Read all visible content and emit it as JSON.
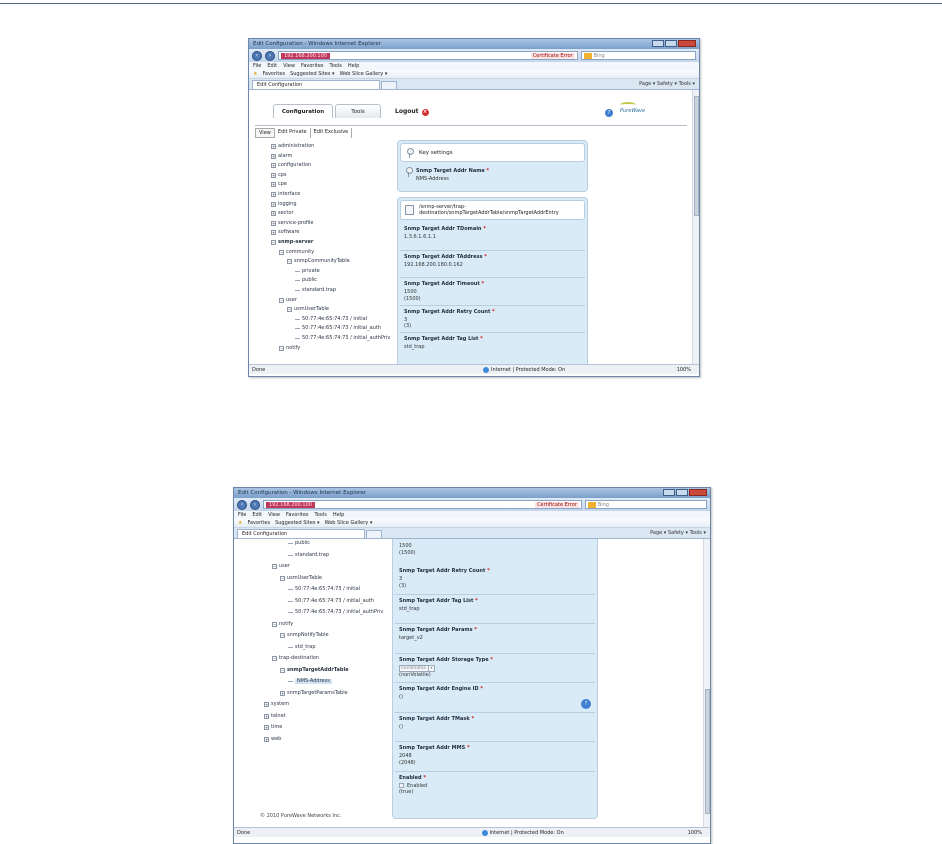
{
  "browser": {
    "title": "Edit Configuration - Windows Internet Explorer",
    "url": "192.168.200.100",
    "certificate_error": "Certificate Error",
    "search_placeholder": "Bing",
    "menu": [
      "File",
      "Edit",
      "View",
      "Favorites",
      "Tools",
      "Help"
    ],
    "favorites_label": "Favorites",
    "suggested_sites": "Suggested Sites ▾",
    "web_slice_gallery": "Web Slice Gallery ▾",
    "tab_title": "Edit Configuration",
    "command_bar": "Page ▾  Safety ▾  Tools ▾",
    "status_left": "Done",
    "status_zone": "Internet | Protected Mode: On",
    "zoom": "100%"
  },
  "app": {
    "tabs": [
      "Configuration",
      "Tools"
    ],
    "logout": "Logout",
    "logo": "PureWave",
    "subtabs": [
      "View",
      "Edit Private",
      "Edit Exclusive"
    ],
    "copyright": "© 2010 PureWave Networks Inc."
  },
  "window1": {
    "tree": [
      {
        "label": "administration",
        "kind": "plus"
      },
      {
        "label": "alarm",
        "kind": "plus"
      },
      {
        "label": "configuration",
        "kind": "plus"
      },
      {
        "label": "cps",
        "kind": "plus"
      },
      {
        "label": "cpe",
        "kind": "plus"
      },
      {
        "label": "interface",
        "kind": "plus"
      },
      {
        "label": "logging",
        "kind": "plus"
      },
      {
        "label": "sector",
        "kind": "plus"
      },
      {
        "label": "service-profile",
        "kind": "plus"
      },
      {
        "label": "software",
        "kind": "plus"
      },
      {
        "label": "snmp-server",
        "kind": "minus",
        "bold": true
      },
      {
        "label": "community",
        "kind": "minus",
        "indent": 1
      },
      {
        "label": "snmpCommunityTable",
        "kind": "minus",
        "indent": 2
      },
      {
        "label": "private",
        "kind": "leaf",
        "indent": 3
      },
      {
        "label": "public",
        "kind": "leaf",
        "indent": 3
      },
      {
        "label": "standard.trap",
        "kind": "leaf",
        "indent": 3
      },
      {
        "label": "user",
        "kind": "minus",
        "indent": 1
      },
      {
        "label": "usmUserTable",
        "kind": "minus",
        "indent": 2
      },
      {
        "label": "50:77:4e:65:74:73 / initial",
        "kind": "leaf",
        "indent": 3
      },
      {
        "label": "50:77:4e:65:74:73 / initial_auth",
        "kind": "leaf",
        "indent": 3
      },
      {
        "label": "50:77:4e:65:74:73 / initial_authPriv",
        "kind": "leaf",
        "indent": 3
      },
      {
        "label": "notify",
        "kind": "minus",
        "indent": 1
      }
    ],
    "key_settings_title": "Key settings",
    "key_field_label": "Snmp Target Addr Name",
    "key_field_value": "NMS-Address",
    "path_title": "/snmp-server/trap-destination/snmpTargetAddrTable/snmpTargetAddrEntry",
    "fields": [
      {
        "label": "Snmp Target Addr TDomain",
        "value": "1.3.6.1.6.1.1",
        "value2": ""
      },
      {
        "label": "Snmp Target Addr TAddress",
        "value": "192.168.200.180.0.162",
        "value2": ""
      },
      {
        "label": "Snmp Target Addr Timeout",
        "value": "1500",
        "value2": "(1500)"
      },
      {
        "label": "Snmp Target Addr Retry Count",
        "value": "3",
        "value2": "(3)"
      },
      {
        "label": "Snmp Target Addr Tag List",
        "value": "std_trap",
        "value2": ""
      }
    ]
  },
  "window2": {
    "tree": [
      {
        "label": "public",
        "kind": "leaf",
        "indent": 3
      },
      {
        "label": "standard.trap",
        "kind": "leaf",
        "indent": 3
      },
      {
        "label": "user",
        "kind": "minus",
        "indent": 1
      },
      {
        "label": "usmUserTable",
        "kind": "minus",
        "indent": 2
      },
      {
        "label": "50:77:4e:65:74:73 / initial",
        "kind": "leaf",
        "indent": 3
      },
      {
        "label": "50:77:4e:65:74:73 / initial_auth",
        "kind": "leaf",
        "indent": 3
      },
      {
        "label": "50:77:4e:65:74:73 / initial_authPriv",
        "kind": "leaf",
        "indent": 3
      },
      {
        "label": "notify",
        "kind": "minus",
        "indent": 1
      },
      {
        "label": "snmpNotifyTable",
        "kind": "minus",
        "indent": 2
      },
      {
        "label": "std_trap",
        "kind": "leaf",
        "indent": 3
      },
      {
        "label": "trap-destination",
        "kind": "minus",
        "indent": 1
      },
      {
        "label": "snmpTargetAddrTable",
        "kind": "minus",
        "indent": 2,
        "bold": true
      },
      {
        "label": "NMS-Address",
        "kind": "leaf",
        "indent": 3,
        "selected": true
      },
      {
        "label": "snmpTargetParamsTable",
        "kind": "plus",
        "indent": 2
      },
      {
        "label": "system",
        "kind": "plus"
      },
      {
        "label": "telnet",
        "kind": "plus"
      },
      {
        "label": "time",
        "kind": "plus"
      },
      {
        "label": "web",
        "kind": "plus"
      }
    ],
    "top_values": [
      "1500",
      "(1500)"
    ],
    "fields": [
      {
        "label": "Snmp Target Addr Retry Count",
        "value": "3",
        "value2": "(3)"
      },
      {
        "label": "Snmp Target Addr Tag List",
        "value": "std_trap",
        "value2": ""
      },
      {
        "label": "Snmp Target Addr Params",
        "value": "target_v2",
        "value2": ""
      },
      {
        "label": "Snmp Target Addr Storage Type",
        "value": "",
        "value2": "(nonVolatile)",
        "select": "nonVolatile"
      },
      {
        "label": "Snmp Target Addr Engine ID",
        "value": "()",
        "value2": ""
      },
      {
        "label": "Snmp Target Addr TMask",
        "value": "()",
        "value2": ""
      },
      {
        "label": "Snmp Target Addr MMS",
        "value": "2048",
        "value2": "(2048)"
      },
      {
        "label": "Enabled",
        "value": "",
        "value2": "(true)",
        "checkbox": "Enabled"
      }
    ]
  }
}
